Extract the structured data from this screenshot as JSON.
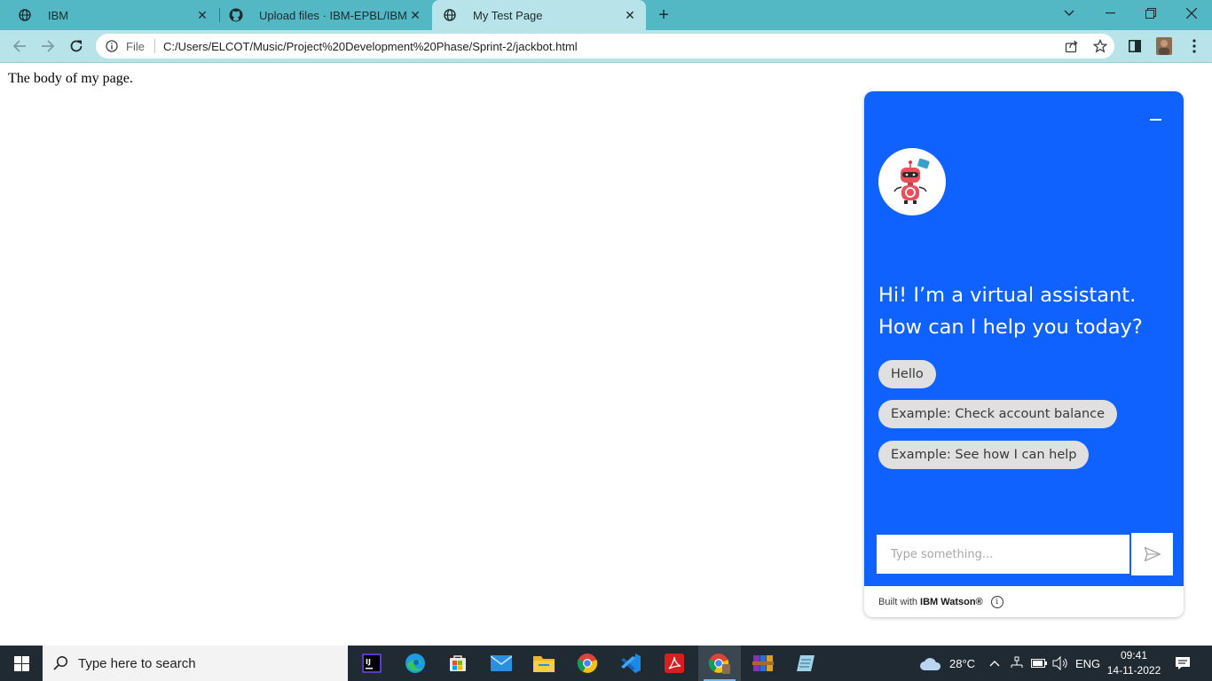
{
  "browser": {
    "tabs": [
      {
        "title": "IBM",
        "icon": "globe-icon",
        "active": false
      },
      {
        "title": "Upload files · IBM-EPBL/IBM-Proj",
        "icon": "github-icon",
        "active": false
      },
      {
        "title": "My Test Page",
        "icon": "globe-icon",
        "active": true
      }
    ],
    "address": {
      "scheme_label": "File",
      "url": "C:/Users/ELCOT/Music/Project%20Development%20Phase/Sprint-2/jackbot.html"
    },
    "colors": {
      "frame": "#53b7c4",
      "toolbar": "#b8e3e9"
    }
  },
  "page": {
    "body_text": "The body of my page."
  },
  "chat": {
    "greeting": "Hi! I’m a virtual assistant. How can I help you today?",
    "suggestions": [
      "Hello",
      "Example: Check account balance",
      "Example: See how I can help"
    ],
    "input_placeholder": "Type something...",
    "footer_prefix": "Built with",
    "footer_brand": "IBM Watson®",
    "colors": {
      "accent": "#0f62fe",
      "chip": "#e0e0e0",
      "avatar_robot": "#e8505b"
    }
  },
  "taskbar": {
    "search_placeholder": "Type here to search",
    "apps": [
      "intellij-icon",
      "edge-icon",
      "store-icon",
      "mail-icon",
      "file-explorer-icon",
      "chrome-icon",
      "vscode-icon",
      "acrobat-icon",
      "chrome-profile-icon",
      "winrar-icon",
      "notepad-icon"
    ],
    "weather_temp": "28°C",
    "language": "ENG",
    "time": "09:41",
    "date": "14-11-2022"
  }
}
